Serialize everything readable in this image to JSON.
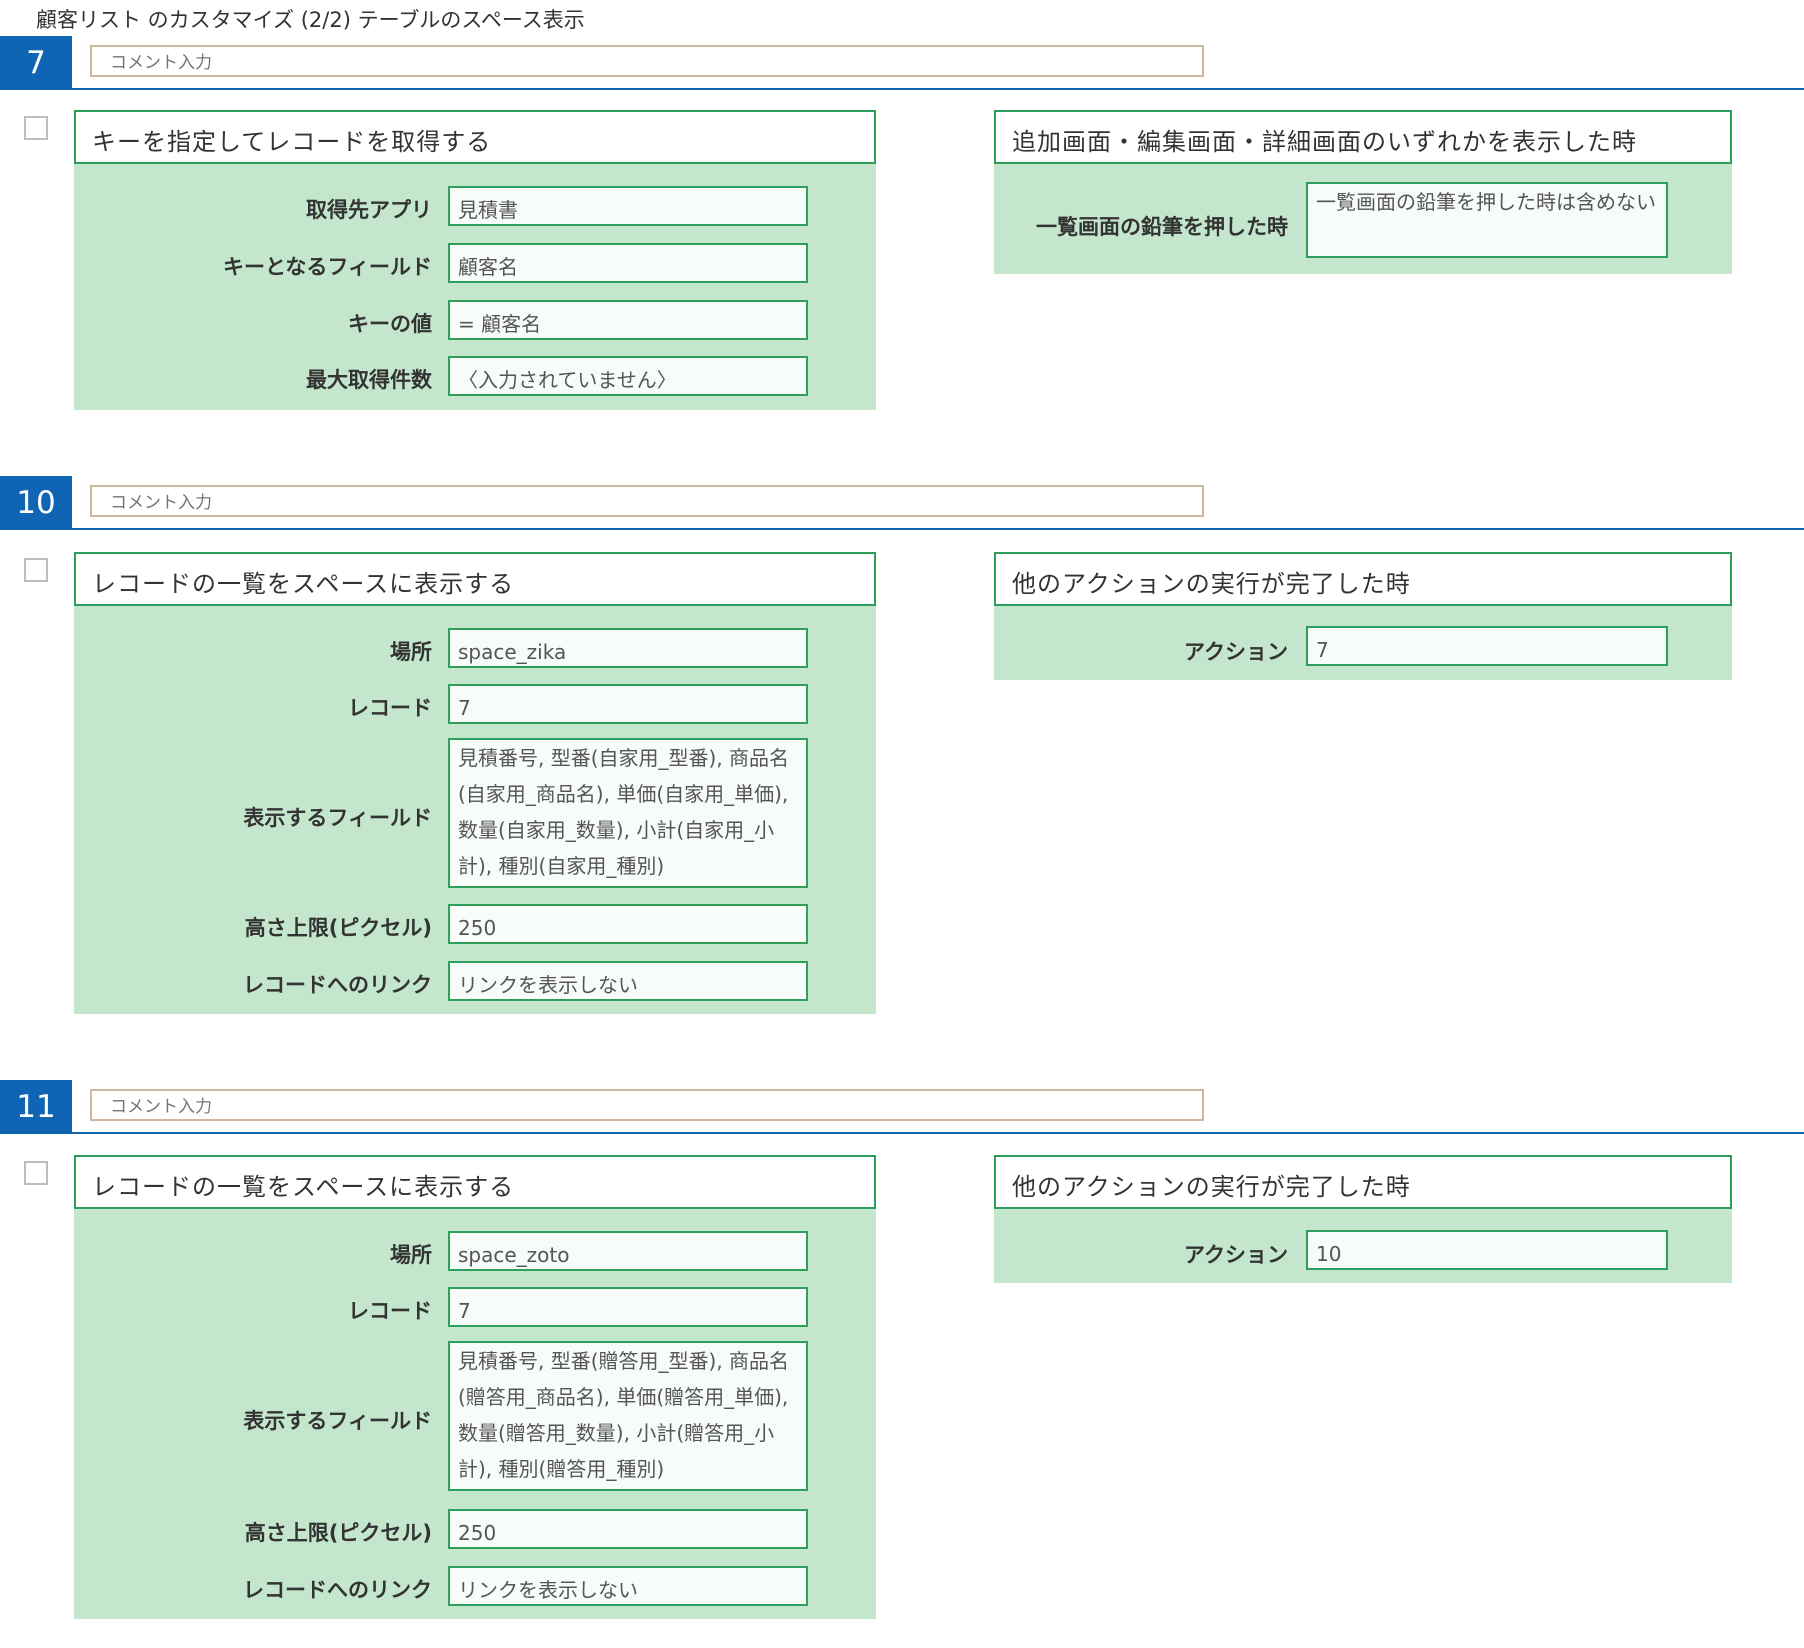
{
  "page_title": "顧客リスト のカスタマイズ (2/2) テーブルのスペース表示",
  "comment_placeholder": "コメント入力",
  "sections": [
    {
      "number": "7",
      "action": {
        "title": "キーを指定してレコードを取得する",
        "fields": [
          {
            "label": "取得先アプリ",
            "value": "見積書"
          },
          {
            "label": "キーとなるフィールド",
            "value": "顧客名"
          },
          {
            "label": "キーの値",
            "value": "= 顧客名"
          },
          {
            "label": "最大取得件数",
            "value": "〈入力されていません〉"
          }
        ]
      },
      "trigger": {
        "title": "追加画面・編集画面・詳細画面のいずれかを表示した時",
        "fields": [
          {
            "label": "一覧画面の鉛筆を押した時",
            "value": "一覧画面の鉛筆を押した時は含めない"
          }
        ]
      }
    },
    {
      "number": "10",
      "action": {
        "title": "レコードの一覧をスペースに表示する",
        "fields": [
          {
            "label": "場所",
            "value": "space_zika"
          },
          {
            "label": "レコード",
            "value": "7"
          },
          {
            "label": "表示するフィールド",
            "value": "見積番号, 型番(自家用_型番), 商品名(自家用_商品名), 単価(自家用_単価), 数量(自家用_数量), 小計(自家用_小計), 種別(自家用_種別)"
          },
          {
            "label": "高さ上限(ピクセル)",
            "value": "250"
          },
          {
            "label": "レコードへのリンク",
            "value": "リンクを表示しない"
          }
        ]
      },
      "trigger": {
        "title": "他のアクションの実行が完了した時",
        "fields": [
          {
            "label": "アクション",
            "value": "7"
          }
        ]
      }
    },
    {
      "number": "11",
      "action": {
        "title": "レコードの一覧をスペースに表示する",
        "fields": [
          {
            "label": "場所",
            "value": "space_zoto"
          },
          {
            "label": "レコード",
            "value": "7"
          },
          {
            "label": "表示するフィールド",
            "value": "見積番号, 型番(贈答用_型番), 商品名(贈答用_商品名), 単価(贈答用_単価), 数量(贈答用_数量), 小計(贈答用_小計), 種別(贈答用_種別)"
          },
          {
            "label": "高さ上限(ピクセル)",
            "value": "250"
          },
          {
            "label": "レコードへのリンク",
            "value": "リンクを表示しない"
          }
        ]
      },
      "trigger": {
        "title": "他のアクションの実行が完了した時",
        "fields": [
          {
            "label": "アクション",
            "value": "10"
          }
        ]
      }
    }
  ],
  "colors": {
    "accent_blue": "#0f64b4",
    "panel_green": "#c3e6cc",
    "border_green": "#2e9e5b",
    "comment_border": "#cdb8a0"
  }
}
